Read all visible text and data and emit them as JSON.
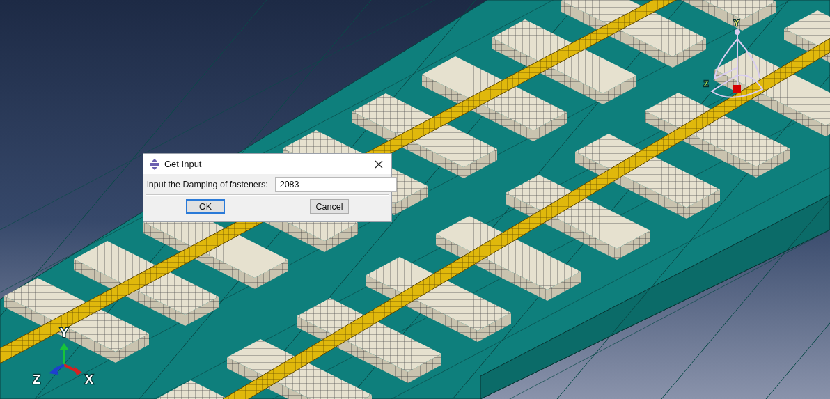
{
  "viewport": {
    "triad_labels": [
      "Y",
      "Z",
      "X"
    ],
    "csys_labels": [
      "Y",
      "Z"
    ]
  },
  "dialog": {
    "title": "Get Input",
    "prompt": "input the Damping of fasteners:",
    "value": "2083",
    "buttons": [
      {
        "label": "OK",
        "default": true
      },
      {
        "label": "Cancel",
        "default": false
      }
    ]
  }
}
